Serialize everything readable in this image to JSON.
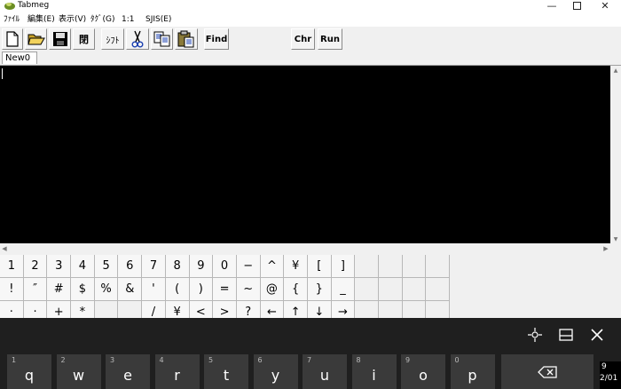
{
  "window": {
    "title": "Tabmeg",
    "min_glyph": "—",
    "close_glyph": "✕"
  },
  "menu": [
    "ﾌｧｲﾙ",
    "編集(E)",
    "表示(V)",
    "ﾀｸﾞ(G)",
    "1:1",
    "SJIS(E)"
  ],
  "toolbar": {
    "close_label": "閉",
    "shift_label": "ｼﾌﾄ",
    "find_label": "Find",
    "chr_label": "Chr",
    "run_label": "Run"
  },
  "tabs": [
    "New0"
  ],
  "palette": {
    "row1": [
      "1",
      "2",
      "3",
      "4",
      "5",
      "6",
      "7",
      "8",
      "9",
      "0",
      "−",
      "^",
      "¥",
      "[",
      "]",
      "",
      "",
      "",
      ""
    ],
    "row2": [
      "!",
      "″",
      "#",
      "$",
      "%",
      "&",
      "'",
      "(",
      ")",
      "=",
      "~",
      "@",
      "{",
      "}",
      "_",
      "",
      "",
      "",
      ""
    ],
    "row3": [
      "·",
      "·",
      "+",
      "*",
      "",
      "",
      "/",
      "¥",
      "<",
      ">",
      "?",
      "←",
      "↑",
      "↓",
      "→",
      "",
      "",
      "",
      ""
    ]
  },
  "keyboard": {
    "keys": [
      {
        "hint": "1",
        "char": "q"
      },
      {
        "hint": "2",
        "char": "w"
      },
      {
        "hint": "3",
        "char": "e"
      },
      {
        "hint": "4",
        "char": "r"
      },
      {
        "hint": "5",
        "char": "t"
      },
      {
        "hint": "6",
        "char": "y"
      },
      {
        "hint": "7",
        "char": "u"
      },
      {
        "hint": "8",
        "char": "i"
      },
      {
        "hint": "9",
        "char": "o"
      },
      {
        "hint": "0",
        "char": "p"
      }
    ]
  },
  "taskbar": {
    "time_fragment": "9",
    "date_fragment": "2/01"
  }
}
